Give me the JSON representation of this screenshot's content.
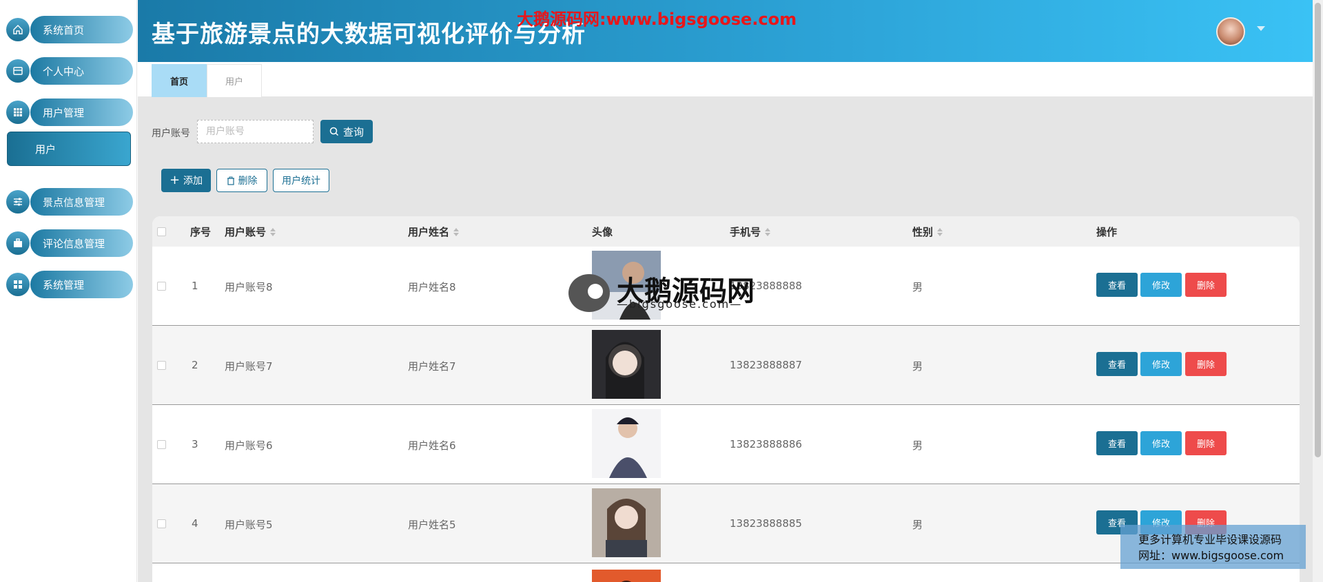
{
  "header": {
    "title": "基于旅游景点的大数据可视化评价与分析",
    "watermark": "大鹅源码网:www.bigsgoose.com"
  },
  "sidebar": {
    "items": [
      {
        "label": "系统首页",
        "icon": "home-icon"
      },
      {
        "label": "个人中心",
        "icon": "profile-icon"
      },
      {
        "label": "用户管理",
        "icon": "grid-icon"
      },
      {
        "label": "景点信息管理",
        "icon": "sliders-icon"
      },
      {
        "label": "评论信息管理",
        "icon": "briefcase-icon"
      },
      {
        "label": "系统管理",
        "icon": "apps-icon"
      }
    ],
    "sub_item": "用户"
  },
  "tabs": [
    {
      "label": "首页"
    },
    {
      "label": "用户"
    }
  ],
  "search": {
    "label": "用户账号",
    "placeholder": "用户账号",
    "button": "查询"
  },
  "toolbar": {
    "add": "添加",
    "delete": "删除",
    "stats": "用户统计"
  },
  "table": {
    "headers": [
      "序号",
      "用户账号",
      "用户姓名",
      "头像",
      "手机号",
      "性别",
      "操作"
    ],
    "rows": [
      {
        "no": "1",
        "account": "用户账号8",
        "name": "用户姓名8",
        "phone": "13823888888",
        "gender": "男"
      },
      {
        "no": "2",
        "account": "用户账号7",
        "name": "用户姓名7",
        "phone": "13823888887",
        "gender": "男"
      },
      {
        "no": "3",
        "account": "用户账号6",
        "name": "用户姓名6",
        "phone": "13823888886",
        "gender": "男"
      },
      {
        "no": "4",
        "account": "用户账号5",
        "name": "用户姓名5",
        "phone": "13823888885",
        "gender": "男"
      }
    ],
    "actions": {
      "view": "查看",
      "edit": "修改",
      "delete": "删除"
    }
  },
  "watermarks": {
    "center_title": "大鹅源码网",
    "center_sub": "—bigsgoose.com—",
    "box_line1": "更多计算机专业毕设课设源码",
    "box_line2": "网址：www.bigsgoose.com"
  },
  "colors": {
    "primary": "#1b6f93",
    "accent": "#2da4d8",
    "danger": "#ee4b4b",
    "watermark_red": "#e8161a"
  }
}
